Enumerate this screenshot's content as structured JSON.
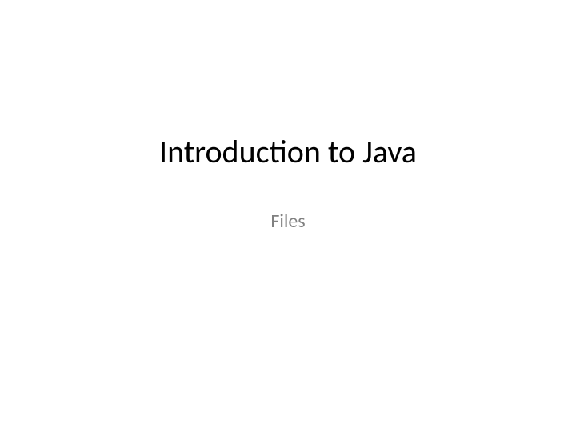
{
  "slide": {
    "title": "Introduction to Java",
    "subtitle": "Files"
  }
}
